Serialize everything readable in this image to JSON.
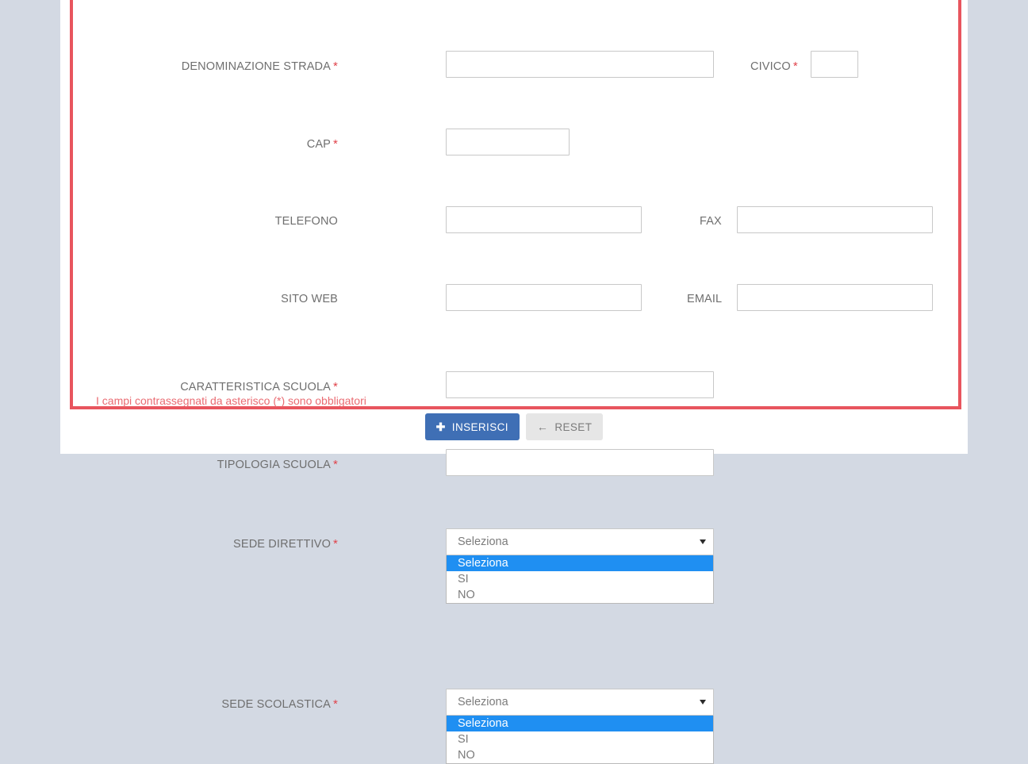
{
  "theme": {
    "panel_border": "#e8555e",
    "page_bg": "#d3d9e3",
    "label_color": "#6f6f6f",
    "required_color": "#e0424a",
    "highlight_color": "#1f8ff2",
    "primary_button": "#3f6fb5",
    "default_button": "#e6e6e6"
  },
  "form": {
    "note": "I campi contrassegnati da asterisco (*) sono obbligatori",
    "required_mark": "*",
    "fields": {
      "denominazione_strada": {
        "label": "DENOMINAZIONE STRADA",
        "value": "",
        "placeholder": ""
      },
      "civico": {
        "label": "CIVICO",
        "value": "",
        "placeholder": ""
      },
      "cap": {
        "label": "CAP",
        "value": "",
        "placeholder": ""
      },
      "telefono": {
        "label": "TELEFONO",
        "value": "",
        "placeholder": ""
      },
      "fax": {
        "label": "FAX",
        "value": "",
        "placeholder": ""
      },
      "sito_web": {
        "label": "SITO WEB",
        "value": "",
        "placeholder": ""
      },
      "email": {
        "label": "EMAIL",
        "value": "",
        "placeholder": ""
      },
      "caratteristica_scuola": {
        "label": "CARATTERISTICA SCUOLA",
        "value": "",
        "placeholder": ""
      },
      "tipologia_scuola": {
        "label": "TIPOLOGIA SCUOLA",
        "value": "",
        "placeholder": ""
      },
      "sede_direttivo": {
        "label": "SEDE DIRETTIVO",
        "selected": "Seleziona",
        "open": true,
        "options": [
          "Seleziona",
          "SI",
          "NO"
        ],
        "highlighted": "Seleziona"
      },
      "sede_scolastica": {
        "label": "SEDE SCOLASTICA",
        "selected": "Seleziona",
        "open": true,
        "options": [
          "Seleziona",
          "SI",
          "NO"
        ],
        "highlighted": "Seleziona"
      }
    }
  },
  "buttons": {
    "submit": {
      "label": "INSERISCI",
      "icon": "plus-icon",
      "glyph": "✚"
    },
    "reset": {
      "label": "RESET",
      "icon": "arrow-left-icon",
      "glyph": "←"
    }
  }
}
